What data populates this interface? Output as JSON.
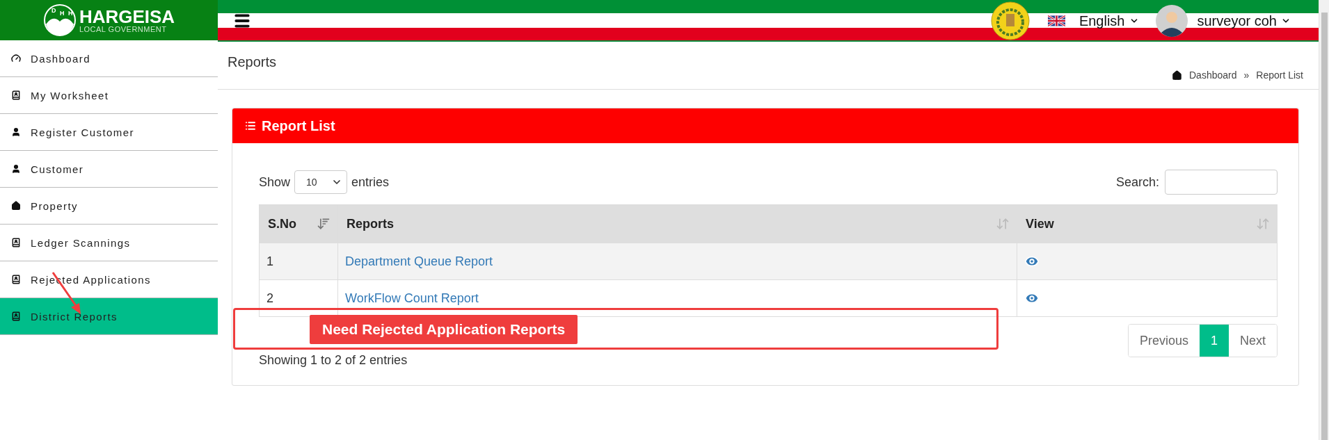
{
  "brand": {
    "title": "HARGEISA",
    "subtitle": "LOCAL GOVERNMENT",
    "initials": [
      "D",
      "H",
      "H"
    ]
  },
  "sidebar": {
    "items": [
      {
        "label": "Dashboard",
        "kind": "gauge",
        "selected": false
      },
      {
        "label": "My Worksheet",
        "kind": "book",
        "selected": false
      },
      {
        "label": "Register Customer",
        "kind": "user",
        "selected": false
      },
      {
        "label": "Customer",
        "kind": "user",
        "selected": false
      },
      {
        "label": "Property",
        "kind": "home",
        "selected": false
      },
      {
        "label": "Ledger Scannings",
        "kind": "book",
        "selected": false
      },
      {
        "label": "Rejected Applications",
        "kind": "book",
        "selected": false
      },
      {
        "label": "District Reports",
        "kind": "book",
        "selected": true
      }
    ]
  },
  "topbar": {
    "language": "English",
    "user": "surveyor coh"
  },
  "page": {
    "title": "Reports",
    "breadcrumb": [
      "Dashboard",
      "»",
      "Report List"
    ]
  },
  "card": {
    "title": "Report List",
    "length_label_before": "Show",
    "length_value": "10",
    "length_label_after": "entries",
    "search_label": "Search:",
    "columns": [
      {
        "label": "S.No",
        "sorted": true
      },
      {
        "label": "Reports",
        "sorted": false
      },
      {
        "label": "View",
        "sorted": false
      }
    ],
    "rows": [
      {
        "no": "1",
        "report": "Department Queue Report",
        "hovered": true
      },
      {
        "no": "2",
        "report": "WorkFlow Count Report",
        "hovered": false
      }
    ],
    "info": "Showing 1 to 2 of 2 entries",
    "pagination": [
      {
        "label": "Previous",
        "selected": false
      },
      {
        "label": "1",
        "selected": true
      },
      {
        "label": "Next",
        "selected": false
      }
    ]
  },
  "annotation": {
    "callout": "Need Rejected Application Reports"
  }
}
